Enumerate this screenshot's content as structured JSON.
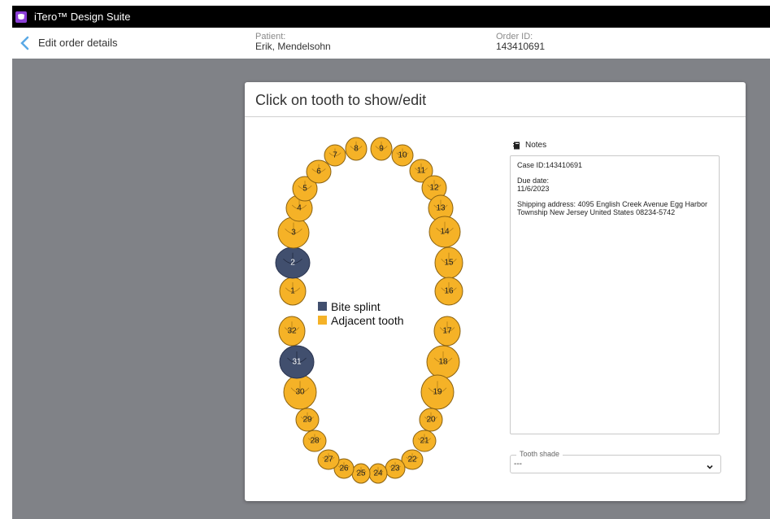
{
  "app": {
    "title": "iTero™ Design Suite"
  },
  "header": {
    "edit_label": "Edit order details",
    "patient_label": "Patient:",
    "patient_value": "Erik, Mendelsohn",
    "order_label": "Order ID:",
    "order_value": "143410691"
  },
  "panel": {
    "title": "Click on tooth to show/edit"
  },
  "legend": {
    "splint": "Bite splint",
    "adjacent": "Adjacent tooth"
  },
  "colors": {
    "splint": "#414f6e",
    "adjacent": "#f5b227"
  },
  "teeth": [
    {
      "num": "1",
      "state": "adjacent"
    },
    {
      "num": "2",
      "state": "splint"
    },
    {
      "num": "3",
      "state": "adjacent"
    },
    {
      "num": "4",
      "state": "adjacent"
    },
    {
      "num": "5",
      "state": "adjacent"
    },
    {
      "num": "6",
      "state": "adjacent"
    },
    {
      "num": "7",
      "state": "adjacent"
    },
    {
      "num": "8",
      "state": "adjacent"
    },
    {
      "num": "9",
      "state": "adjacent"
    },
    {
      "num": "10",
      "state": "adjacent"
    },
    {
      "num": "11",
      "state": "adjacent"
    },
    {
      "num": "12",
      "state": "adjacent"
    },
    {
      "num": "13",
      "state": "adjacent"
    },
    {
      "num": "14",
      "state": "adjacent"
    },
    {
      "num": "15",
      "state": "adjacent"
    },
    {
      "num": "16",
      "state": "adjacent"
    },
    {
      "num": "17",
      "state": "adjacent"
    },
    {
      "num": "18",
      "state": "adjacent"
    },
    {
      "num": "19",
      "state": "adjacent"
    },
    {
      "num": "20",
      "state": "adjacent"
    },
    {
      "num": "21",
      "state": "adjacent"
    },
    {
      "num": "22",
      "state": "adjacent"
    },
    {
      "num": "23",
      "state": "adjacent"
    },
    {
      "num": "24",
      "state": "adjacent"
    },
    {
      "num": "25",
      "state": "adjacent"
    },
    {
      "num": "26",
      "state": "adjacent"
    },
    {
      "num": "27",
      "state": "adjacent"
    },
    {
      "num": "28",
      "state": "adjacent"
    },
    {
      "num": "29",
      "state": "adjacent"
    },
    {
      "num": "30",
      "state": "adjacent"
    },
    {
      "num": "31",
      "state": "splint"
    },
    {
      "num": "32",
      "state": "adjacent"
    }
  ],
  "notes": {
    "label": "Notes",
    "case_id": "Case ID:143410691",
    "due_label": "Due date:",
    "due_value": "11/6/2023",
    "shipping": "Shipping address: 4095 English Creek Avenue Egg Harbor Township New Jersey United States 08234-5742"
  },
  "shade": {
    "label": "Tooth shade",
    "value": "---"
  }
}
